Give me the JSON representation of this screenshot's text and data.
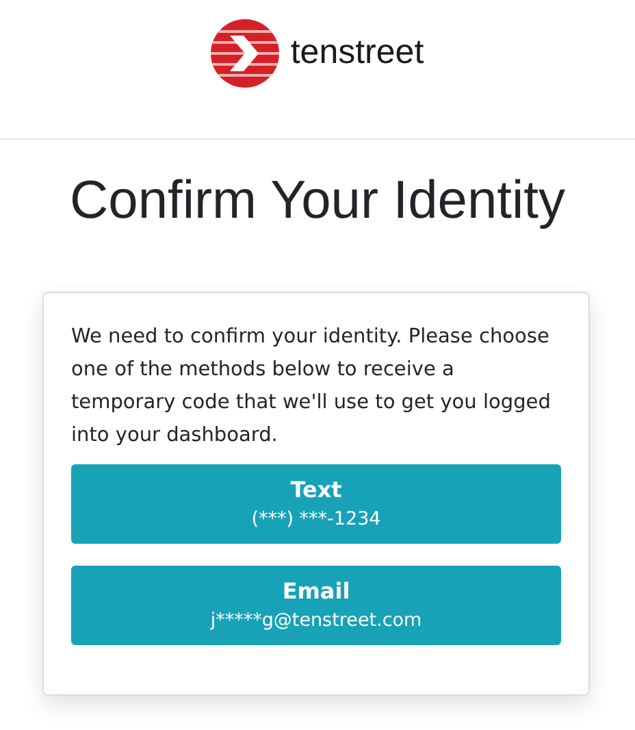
{
  "header": {
    "logo_text": "tenstreet"
  },
  "title": "Confirm Your Identity",
  "card": {
    "message": "We need to confirm your identity. Please choose one of the methods below to receive a temporary code that we'll use to get you logged into your dashboard.",
    "methods": [
      {
        "label": "Text",
        "detail": "(***) ***-1234"
      },
      {
        "label": "Email",
        "detail": "j*****g@tenstreet.com"
      }
    ]
  }
}
